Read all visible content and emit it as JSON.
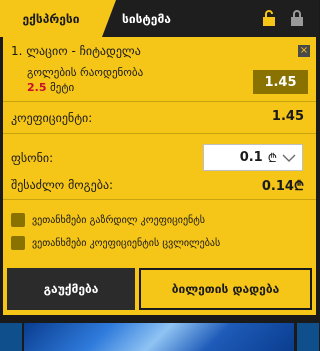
{
  "tabs": {
    "express": "ექსპრესი",
    "system": "სისტემა"
  },
  "icons": {
    "unlock": "unlock-icon",
    "lock": "lock-icon",
    "close": "close-icon",
    "currency": "lari-icon",
    "dropdown": "chevron-down-icon"
  },
  "bet": {
    "title": "1. ლაციო - ჩიტადელა",
    "market": "გოლების რაოდენობა",
    "selection_value": "2.5",
    "selection_label": "მეტი",
    "odds": "1.45",
    "close": "×"
  },
  "summary": {
    "coef_label": "კოეფიციენტი:",
    "coef_value": "1.45",
    "stake_label": "ფსონი:",
    "stake_value": "0.1",
    "currency_symbol": "₾",
    "win_label": "შესაძლო მოგება:",
    "win_value": "0.14₾"
  },
  "options": [
    {
      "label": "ვეთანხმები გაზრდილ კოეფიციენტს"
    },
    {
      "label": "ვეთანხმები კოეფიციენტის ცვლილებას"
    }
  ],
  "buttons": {
    "clear": "გაუქმება",
    "place": "ბილეთის დადება"
  },
  "colors": {
    "accent": "#f5c518",
    "dark": "#1a1a1a",
    "odds_bg": "#8a7200",
    "highlight": "#c8102e"
  }
}
